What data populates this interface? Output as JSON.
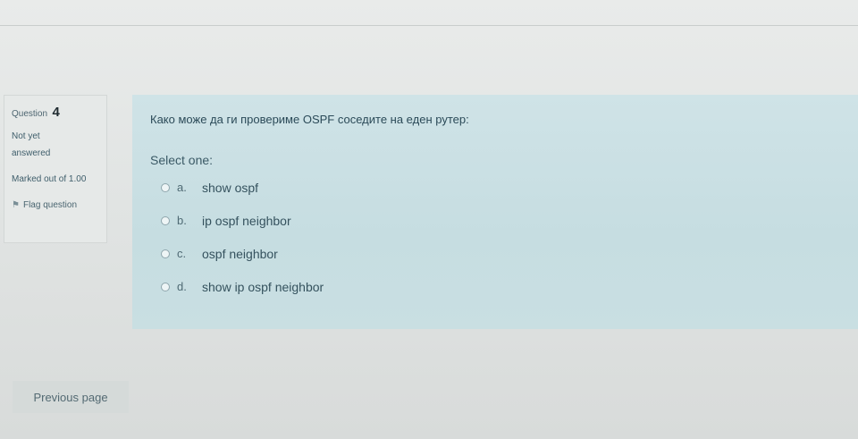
{
  "info": {
    "question_label": "Question",
    "question_number": "4",
    "state": "Not yet answered",
    "grade": "Marked out of 1.00",
    "flag_label": "Flag question"
  },
  "question": {
    "text": "Како може да ги провериме OSPF соседите на еден рутер:",
    "prompt": "Select one:",
    "answers": [
      {
        "letter": "a.",
        "text": "show ospf"
      },
      {
        "letter": "b.",
        "text": "ip ospf neighbor"
      },
      {
        "letter": "c.",
        "text": "ospf neighbor"
      },
      {
        "letter": "d.",
        "text": "show ip ospf neighbor"
      }
    ]
  },
  "navigation": {
    "previous_label": "Previous page"
  }
}
